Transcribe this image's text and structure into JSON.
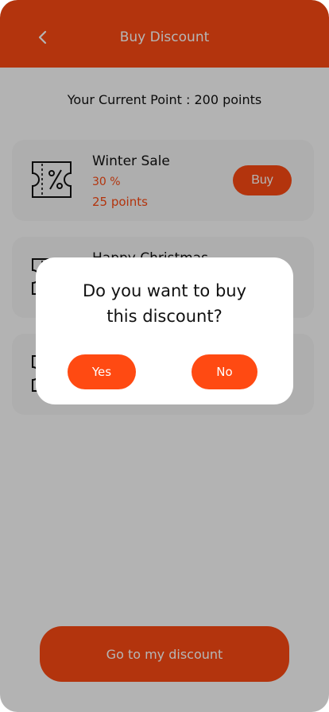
{
  "header": {
    "title": "Buy Discount",
    "back_icon": "chevron-left-icon"
  },
  "points": {
    "text": "Your Current Point : 200 points"
  },
  "discounts": [
    {
      "title": "Winter Sale",
      "percent": "30 %",
      "points": "25 points",
      "buy_label": "Buy"
    },
    {
      "title": "Happy Christmas"
    },
    {
      "title": ""
    }
  ],
  "bottom_button": {
    "label": "Go to my discount"
  },
  "dialog": {
    "message_line1": "Do you want to buy",
    "message_line2": "this discount?",
    "yes_label": "Yes",
    "no_label": "No"
  },
  "colors": {
    "accent": "#fc4a13",
    "card": "#f5f5f5",
    "background": "#fcfcfc"
  }
}
